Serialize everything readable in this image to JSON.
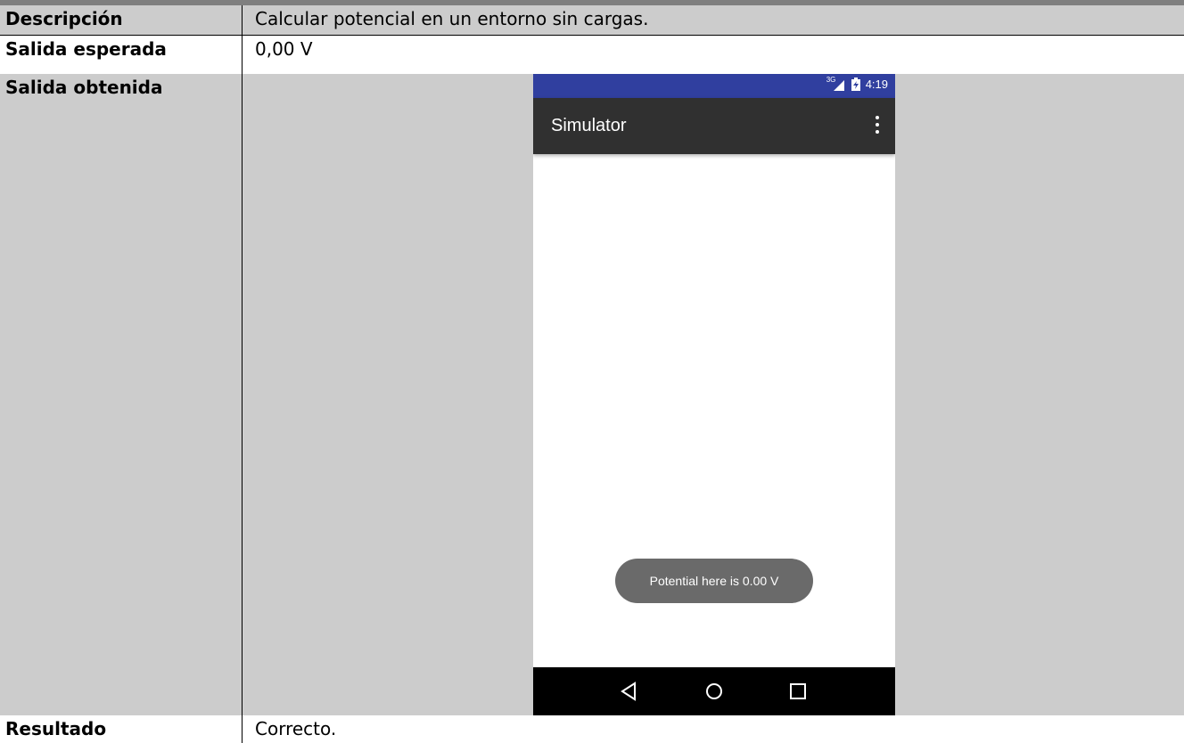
{
  "table": {
    "rows": [
      {
        "label": "Descripción",
        "value": "Calcular potencial en un entorno sin cargas."
      },
      {
        "label": "Salida esperada",
        "value": "0,00 V"
      },
      {
        "label": "Salida obtenida",
        "value": ""
      },
      {
        "label": "Resultado",
        "value": "Correcto."
      }
    ]
  },
  "phone": {
    "status": {
      "network": "3G",
      "time": "4:19"
    },
    "appbar": {
      "title": "Simulator"
    },
    "toast": "Potential here is 0.00 V",
    "icons": {
      "signal": "signal-3g-icon",
      "battery": "battery-charging-icon",
      "overflow": "overflow-menu-icon",
      "back": "back-icon",
      "home": "home-icon",
      "recents": "recents-icon"
    }
  },
  "colors": {
    "gray_cell": "#cccccc",
    "status_bar": "#303f9f",
    "app_bar": "#303030",
    "toast": "#6a6a6a",
    "nav_bar": "#000000"
  }
}
